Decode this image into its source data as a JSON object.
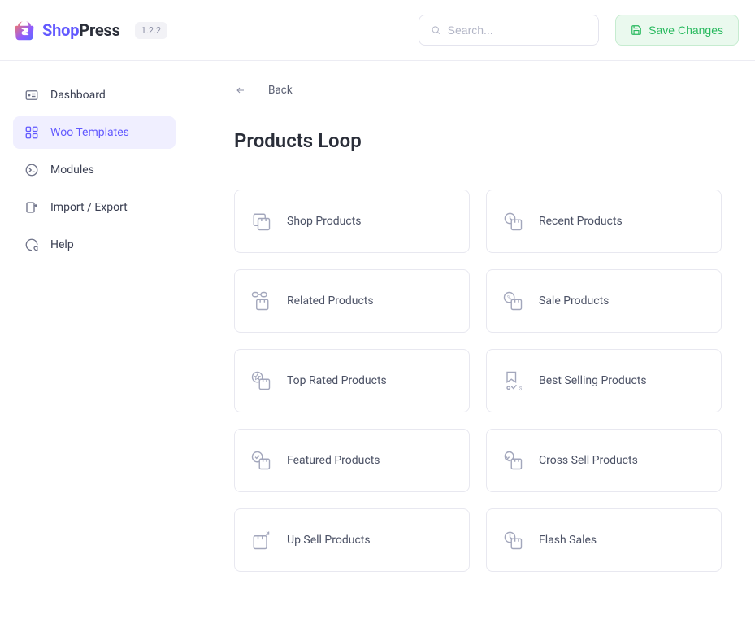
{
  "header": {
    "logo_text_a": "Shop",
    "logo_text_b": "Press",
    "version": "1.2.2",
    "search_placeholder": "Search...",
    "save_label": "Save Changes"
  },
  "sidebar": {
    "items": [
      {
        "label": "Dashboard"
      },
      {
        "label": "Woo Templates"
      },
      {
        "label": "Modules"
      },
      {
        "label": "Import / Export"
      },
      {
        "label": "Help"
      }
    ]
  },
  "main": {
    "back_label": "Back",
    "title": "Products Loop",
    "cards": [
      {
        "label": "Shop Products"
      },
      {
        "label": "Recent Products"
      },
      {
        "label": "Related Products"
      },
      {
        "label": "Sale Products"
      },
      {
        "label": "Top Rated Products"
      },
      {
        "label": "Best Selling Products"
      },
      {
        "label": "Featured Products"
      },
      {
        "label": "Cross Sell Products"
      },
      {
        "label": "Up Sell Products"
      },
      {
        "label": "Flash Sales"
      }
    ]
  }
}
